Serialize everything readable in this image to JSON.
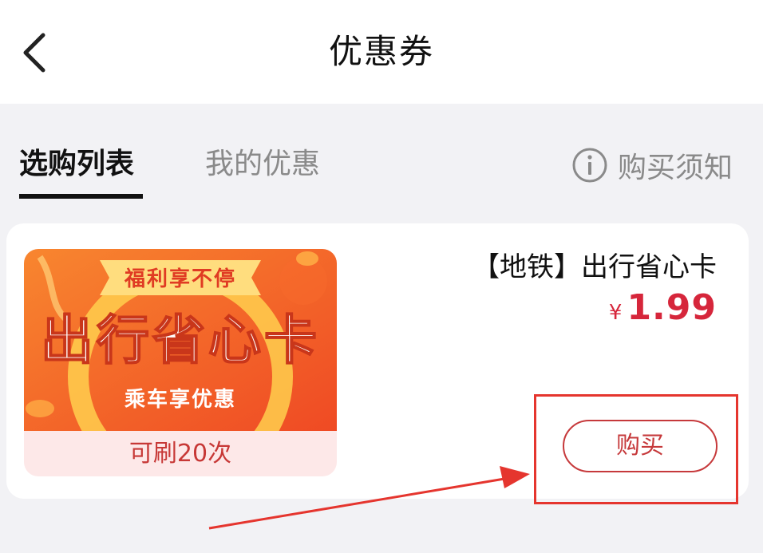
{
  "header": {
    "title": "优惠券",
    "back_icon": "chevron-left-icon"
  },
  "tabs": [
    {
      "label": "选购列表",
      "active": true
    },
    {
      "label": "我的优惠",
      "active": false
    }
  ],
  "notice": {
    "label": "购买须知",
    "icon": "info-icon"
  },
  "product": {
    "banner": {
      "badge": "福利享不停",
      "headline": "出行省心卡",
      "subline": "乘车享优惠",
      "count_label": "可刷20次"
    },
    "name": "【地铁】出行省心卡",
    "currency": "¥",
    "price": "1.99",
    "buy_label": "购买"
  },
  "colors": {
    "accent_red": "#d6263b",
    "banner_orange": "#f55a2c",
    "banner_gold": "#ffd56a"
  }
}
